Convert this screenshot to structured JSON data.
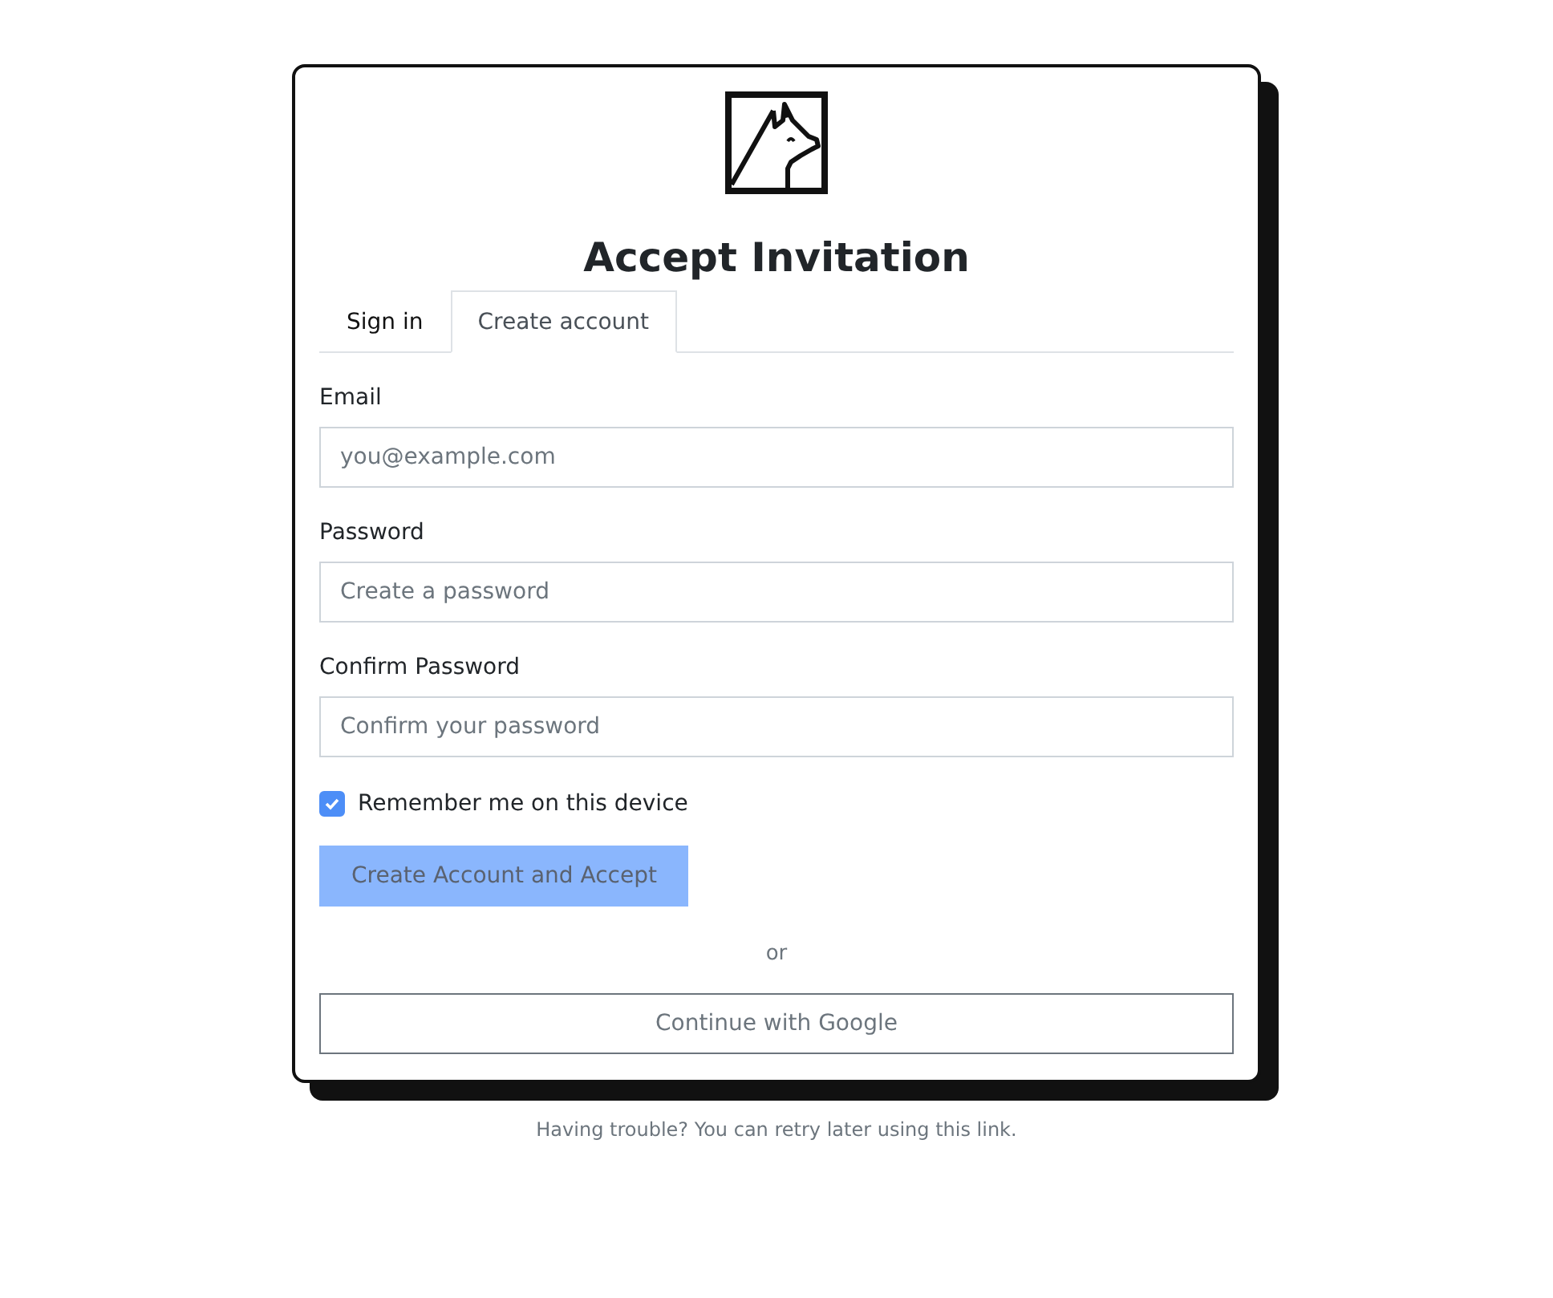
{
  "title": "Accept Invitation",
  "tabs": [
    {
      "label": "Sign in",
      "selected": false
    },
    {
      "label": "Create account",
      "selected": true
    }
  ],
  "fields": [
    {
      "label": "Email",
      "placeholder": "you@example.com"
    },
    {
      "label": "Password",
      "placeholder": "Create a password"
    },
    {
      "label": "Confirm Password",
      "placeholder": "Confirm your password"
    }
  ],
  "remember": {
    "label": "Remember me on this device",
    "checked": true
  },
  "submit": {
    "label": "Create Account and Accept",
    "disabled": true
  },
  "divider": "or",
  "google_button": "Continue with Google",
  "footer": "Having trouble? You can retry later using this link."
}
